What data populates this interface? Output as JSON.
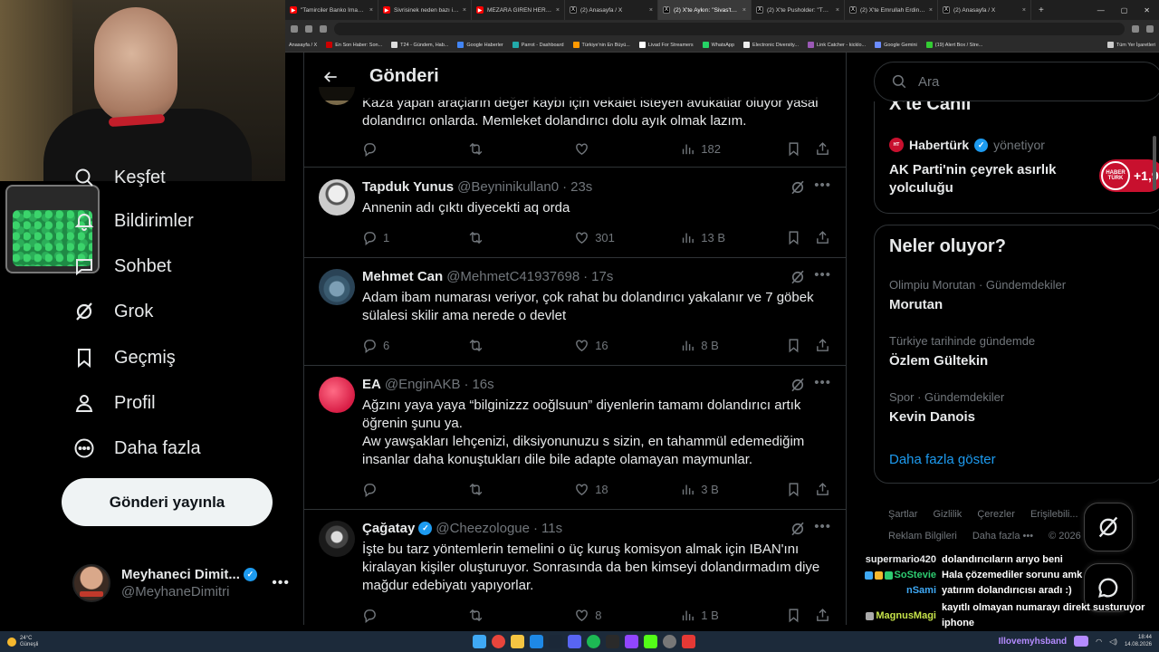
{
  "browser": {
    "tabs": [
      {
        "title": "\"Tamirciler Banko İmamoğ...",
        "icon": "youtube-icon"
      },
      {
        "title": "Sivrisinek neden bazı insa...",
        "icon": "youtube-icon"
      },
      {
        "title": "MEZARA GİREN HERKES ...",
        "icon": "youtube-icon"
      },
      {
        "title": "(2) Anasayfa / X",
        "icon": "x-icon"
      },
      {
        "title": "(2) X'te Aykırı: \"Sivas'ta arı...",
        "icon": "x-icon"
      },
      {
        "title": "(2) X'te Pusholder: \"TOKİ...",
        "icon": "x-icon"
      },
      {
        "title": "(2) X'te Emrullah Erdinç \"...",
        "icon": "x-icon"
      },
      {
        "title": "(2) Anasayfa / X",
        "icon": "x-icon"
      }
    ],
    "bookmarks": [
      "Anasayfa / X",
      "En Son Haber: Son...",
      "T24 - Gündem, Hab...",
      "Google Haberler",
      "Parrot - Dashboard",
      "Türkiye'nin En Büyü...",
      "Livad For Streamers",
      "WhatsApp",
      "Electronic Diversity...",
      "Link Catcher - kicklo...",
      "Google Gemini",
      "(19) Alert Box / Stre..."
    ],
    "bookmarks_other": "Tüm Yer İşaretleri"
  },
  "nav": {
    "items": [
      {
        "label": "Keşfet",
        "icon": "search-icon"
      },
      {
        "label": "Bildirimler",
        "icon": "bell-icon"
      },
      {
        "label": "Sohbet",
        "icon": "chat-icon"
      },
      {
        "label": "Grok",
        "icon": "grok-icon"
      },
      {
        "label": "Geçmiş",
        "icon": "bookmark-icon"
      },
      {
        "label": "Profil",
        "icon": "person-icon"
      },
      {
        "label": "Daha fazla",
        "icon": "more-circle-icon"
      }
    ],
    "post_button": "Gönderi yayınla",
    "account": {
      "name": "Meyhaneci Dimit...",
      "handle": "@MeyhaneDimitri",
      "more": "•••"
    }
  },
  "main": {
    "title": "Gönderi",
    "partial_tweet": {
      "text": "Kaza yapan araçların değer kaybı için vekalet isteyen avukatlar oluyor yasal dolandırıcı onlarda. Memleket dolandırıcı dolu ayık olmak lazım.",
      "replies": "",
      "retweets": "",
      "likes": "",
      "views": "182"
    },
    "tweets": [
      {
        "name": "Tapduk Yunus",
        "handle": "@Beyninikullan0",
        "time": "23s",
        "verified": false,
        "text": "Annenin adı çıktı diyecekti aq orda",
        "replies": "1",
        "retweets": "",
        "likes": "301",
        "views": "13 B",
        "avatar_color": "#d9d9d9"
      },
      {
        "name": "Mehmet Can",
        "handle": "@MehmetC41937698",
        "time": "17s",
        "verified": false,
        "text": "Adam ibam numarası veriyor, çok rahat bu dolandırıcı yakalanır ve 7 göbek sülalesi skilir ama nerede o devlet",
        "replies": "6",
        "retweets": "",
        "likes": "16",
        "views": "8 B",
        "avatar_color": "#4a6f86"
      },
      {
        "name": "EA",
        "handle": "@EnginAKB",
        "time": "16s",
        "verified": false,
        "text": "Ağzını yaya yaya “bilginizzz ooğlsuun” diyenlerin tamamı dolandırıcı artık öğrenin şunu ya.\nAw yawşakları lehçenizi, diksiyonunuzu s sizin, en tahammül edemediğim insanlar daha konuştukları dile bile adapte olamayan maymunlar.",
        "replies": "",
        "retweets": "",
        "likes": "18",
        "views": "3 B",
        "avatar_color": "#e0284a"
      },
      {
        "name": "Çağatay",
        "handle": "@Cheezologue",
        "time": "11s",
        "verified": true,
        "text": "İşte bu tarz yöntemlerin temelini o üç kuruş komisyon almak için IBAN'ını kiralayan kişiler oluşturuyor. Sonrasında da ben kimseyi dolandırmadım diye mağdur edebiyatı yapıyorlar.",
        "replies": "",
        "retweets": "",
        "likes": "8",
        "views": "1 B",
        "avatar_color": "#3a3a3a"
      }
    ]
  },
  "right": {
    "search_placeholder": "Ara",
    "live": {
      "title": "X'te Canlı",
      "host_logo": "HT",
      "host": "Habertürk",
      "host_role": "yönetiyor",
      "description": "AK Parti'nin çeyrek asırlık yolculuğu",
      "pill_logo": "HABER TÜRK",
      "pill_count": "+1,9"
    },
    "trends_title": "Neler oluyor?",
    "trends": [
      {
        "context": "Olimpiu Morutan · Gündemdekiler",
        "name": "Morutan"
      },
      {
        "context": "Türkiye tarihinde gündemde",
        "name": "Özlem Gültekin"
      },
      {
        "context": "Spor · Gündemdekiler",
        "name": "Kevin Danois"
      }
    ],
    "show_more": "Daha fazla göster",
    "footer_row1": [
      "Şartlar",
      "Gizlilik",
      "Çerezler",
      "Erişilebili..."
    ],
    "footer_row2": [
      "Reklam Bilgileri",
      "Daha fazla •••",
      "© 2026"
    ]
  },
  "chat": [
    {
      "user": "supermario420",
      "color": "#e7e9ea",
      "msg": "dolandırıcıların arıyo beni"
    },
    {
      "user": "SoStevie",
      "color": "#2ecc71",
      "msg": "Hala çözemediler sorunu amk"
    },
    {
      "user": "nSami",
      "color": "#3fa9f5",
      "msg": "yatırım dolandırıcısı aradı :)"
    },
    {
      "user": "MagnusMagi",
      "color": "#c6e34a",
      "msg": "kayıtlı olmayan numarayı direkt susturuyor iphone"
    }
  ],
  "taskbar": {
    "temp": "24°C",
    "weather": "Güneşli",
    "tray_user": "Illovemyhsband",
    "time": "18:44",
    "date": "14.08.2026"
  },
  "colors": {
    "accent": "#1d9bf0",
    "background": "#000000",
    "border": "#2f3336",
    "muted": "#71767b"
  }
}
